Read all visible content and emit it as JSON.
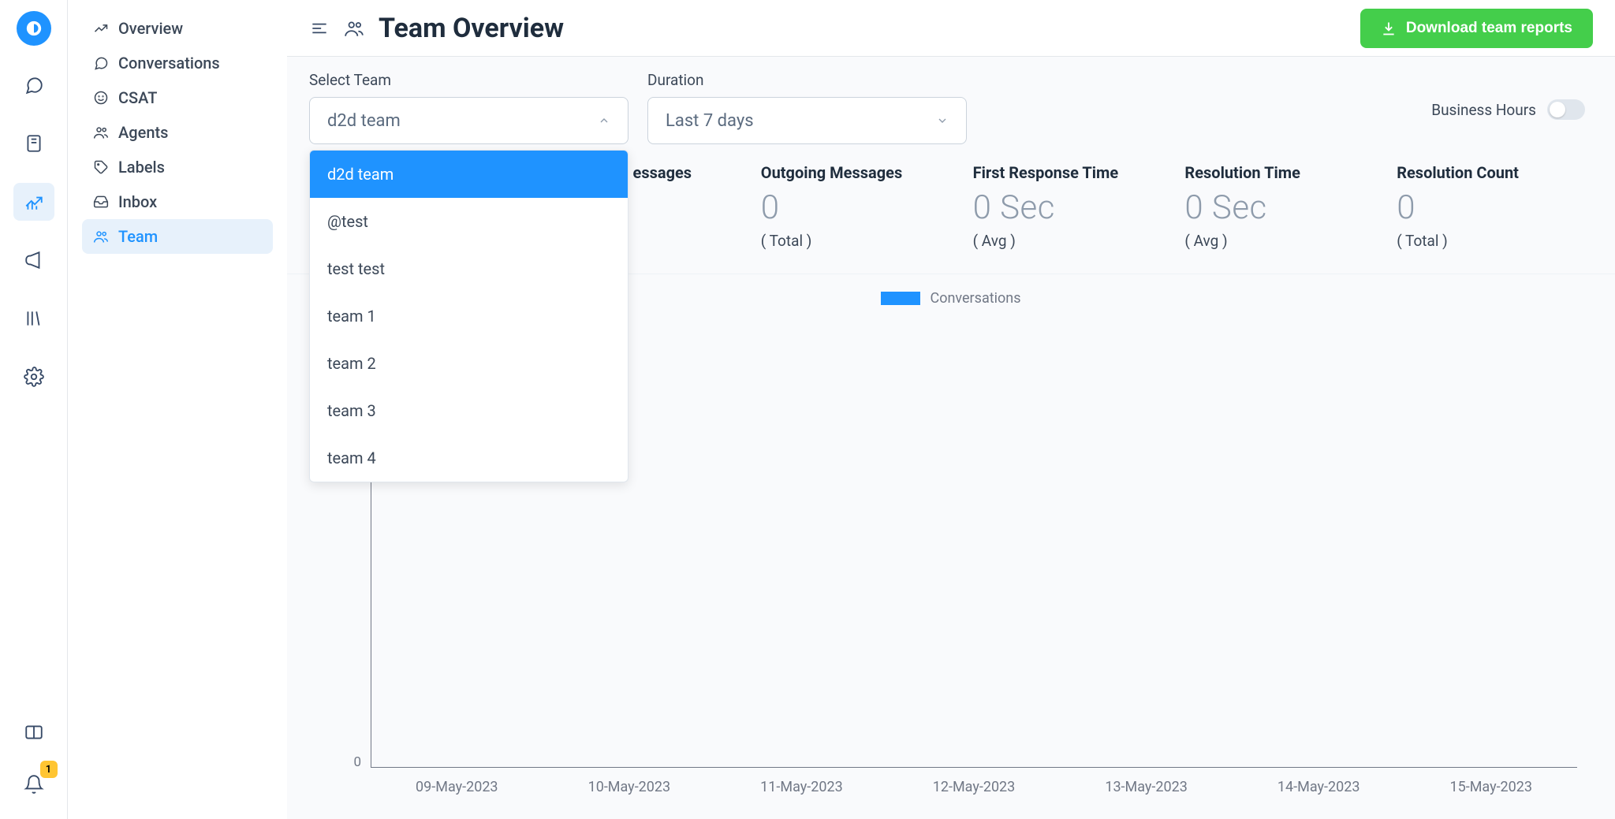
{
  "rail": {
    "notification_count": "1"
  },
  "sidebar": {
    "items": [
      {
        "label": "Overview"
      },
      {
        "label": "Conversations"
      },
      {
        "label": "CSAT"
      },
      {
        "label": "Agents"
      },
      {
        "label": "Labels"
      },
      {
        "label": "Inbox"
      },
      {
        "label": "Team"
      }
    ]
  },
  "header": {
    "title": "Team Overview",
    "download_label": "Download team reports"
  },
  "filters": {
    "team_label": "Select Team",
    "team_selected": "d2d team",
    "duration_label": "Duration",
    "duration_selected": "Last 7 days",
    "biz_hours_label": "Business Hours",
    "team_options": [
      "d2d team",
      "@test",
      "test test",
      "team 1",
      "team 2",
      "team 3",
      "team 4"
    ]
  },
  "metrics": [
    {
      "title": "Incoming Messages",
      "value": "",
      "sub": ""
    },
    {
      "title": "Outgoing Messages",
      "value": "0",
      "sub": "( Total )"
    },
    {
      "title": "First Response Time",
      "value": "0 Sec",
      "sub": "( Avg )"
    },
    {
      "title": "Resolution Time",
      "value": "0 Sec",
      "sub": "( Avg )"
    },
    {
      "title": "Resolution Count",
      "value": "0",
      "sub": "( Total )"
    }
  ],
  "chart_data": {
    "type": "bar",
    "title": "",
    "legend": "Conversations",
    "categories": [
      "09-May-2023",
      "10-May-2023",
      "11-May-2023",
      "12-May-2023",
      "13-May-2023",
      "14-May-2023",
      "15-May-2023"
    ],
    "values": [
      0,
      0,
      0,
      0,
      0,
      0,
      0
    ],
    "ylim": [
      0,
      1
    ],
    "y_ticks": [
      "0"
    ]
  }
}
